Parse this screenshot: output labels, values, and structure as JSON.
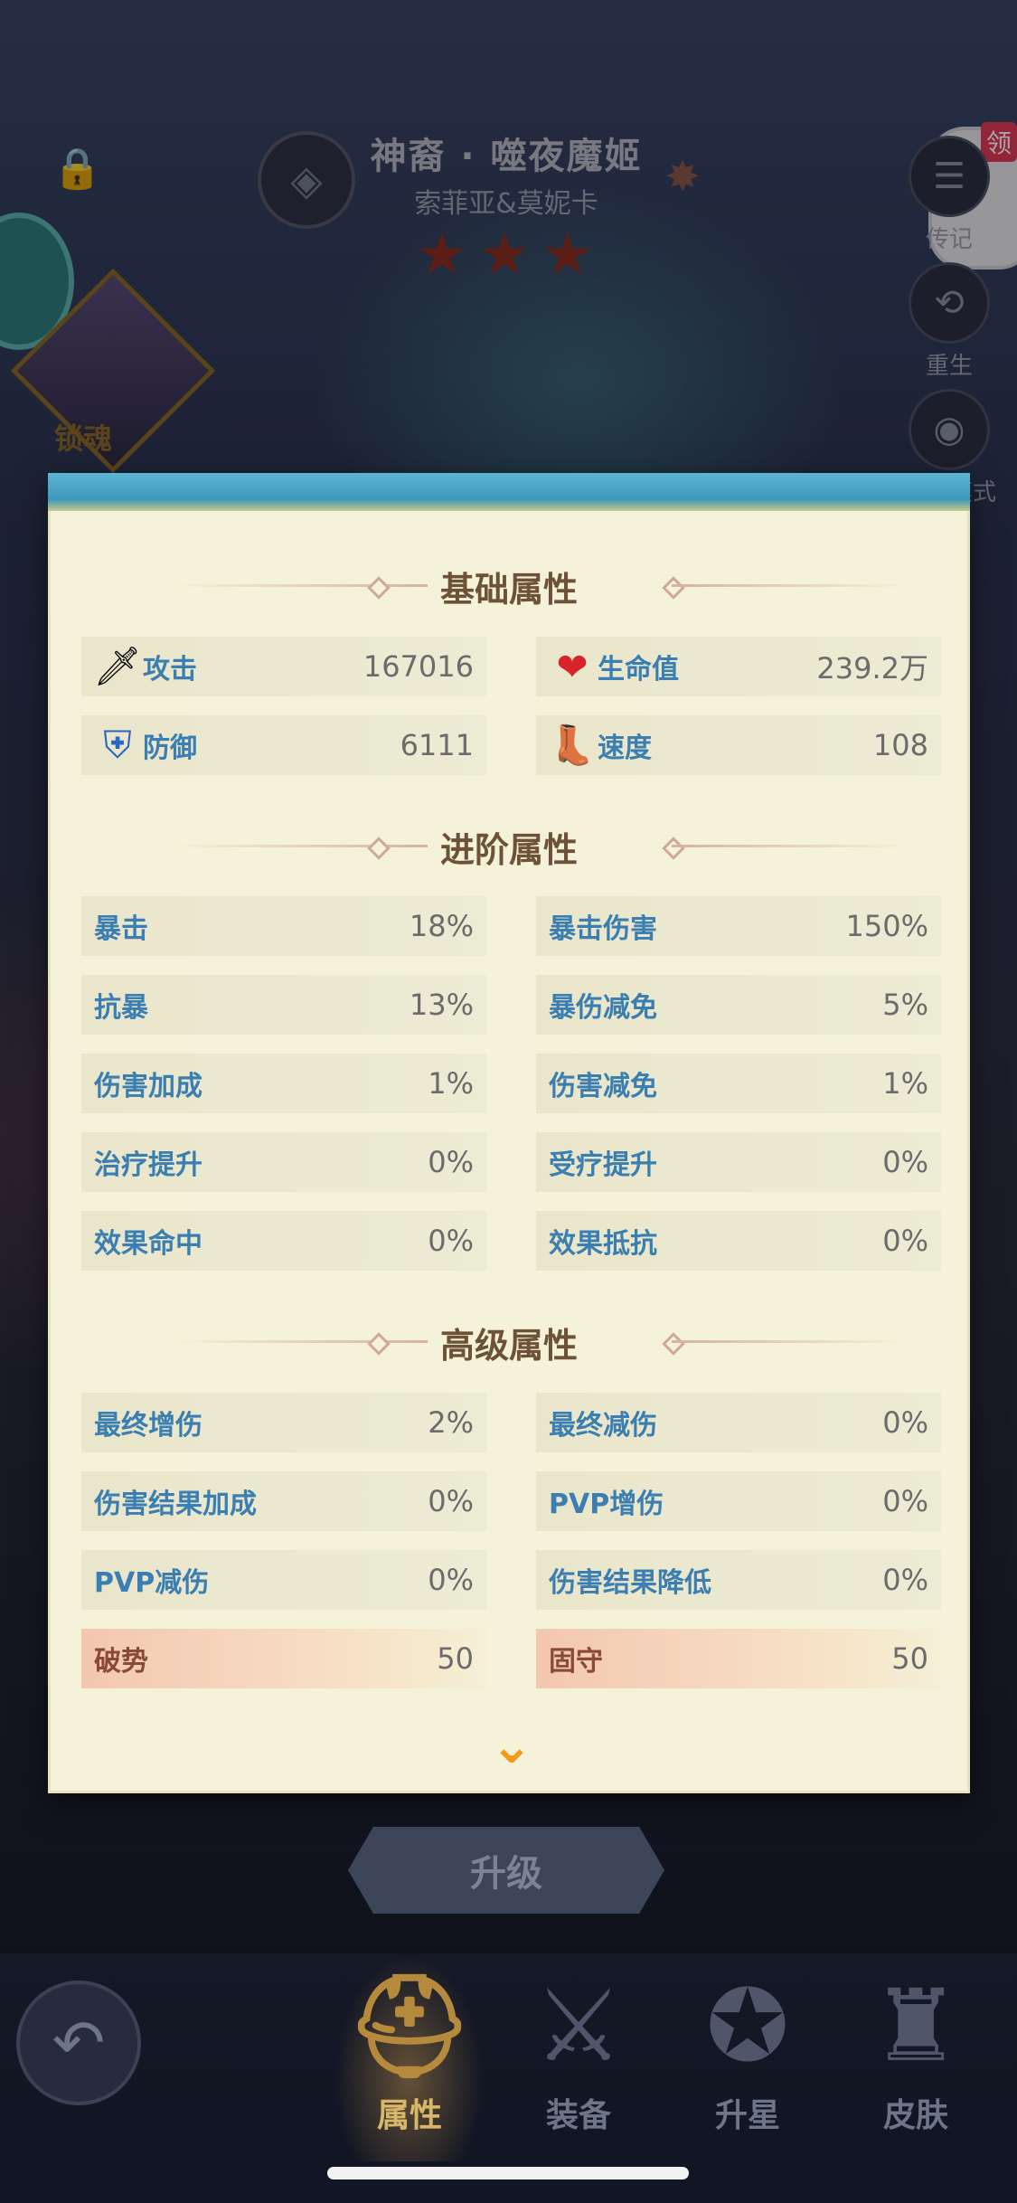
{
  "hero": {
    "name": "神裔 · 噬夜魔姬",
    "subtitle": "索菲亚&莫妮卡",
    "star_count": 3,
    "soul_lock_label": "锁魂"
  },
  "side_buttons": {
    "reward_tag": "领",
    "bio_label": "传记",
    "rebirth_label": "重生",
    "view_mode_label": "观赏模式"
  },
  "panel": {
    "basic": {
      "title": "基础属性",
      "attack": {
        "label": "攻击",
        "value": "167016"
      },
      "hp": {
        "label": "生命值",
        "value": "239.2万"
      },
      "defense": {
        "label": "防御",
        "value": "6111"
      },
      "speed": {
        "label": "速度",
        "value": "108"
      }
    },
    "advanced": {
      "title": "进阶属性",
      "items": [
        {
          "label": "暴击",
          "value": "18%"
        },
        {
          "label": "暴击伤害",
          "value": "150%"
        },
        {
          "label": "抗暴",
          "value": "13%"
        },
        {
          "label": "暴伤减免",
          "value": "5%"
        },
        {
          "label": "伤害加成",
          "value": "1%"
        },
        {
          "label": "伤害减免",
          "value": "1%"
        },
        {
          "label": "治疗提升",
          "value": "0%"
        },
        {
          "label": "受疗提升",
          "value": "0%"
        },
        {
          "label": "效果命中",
          "value": "0%"
        },
        {
          "label": "效果抵抗",
          "value": "0%"
        }
      ]
    },
    "senior": {
      "title": "高级属性",
      "items": [
        {
          "label": "最终增伤",
          "value": "2%"
        },
        {
          "label": "最终减伤",
          "value": "0%"
        },
        {
          "label": "伤害结果加成",
          "value": "0%"
        },
        {
          "label": "PVP增伤",
          "value": "0%"
        },
        {
          "label": "PVP减伤",
          "value": "0%"
        },
        {
          "label": "伤害结果降低",
          "value": "0%"
        },
        {
          "label": "破势",
          "value": "50"
        },
        {
          "label": "固守",
          "value": "50"
        }
      ]
    }
  },
  "upgrade_label": "升级",
  "tabs": [
    {
      "label": "属性",
      "icon": "helmet-icon",
      "active": true
    },
    {
      "label": "装备",
      "icon": "sword-icon",
      "active": false
    },
    {
      "label": "升星",
      "icon": "star-badge-icon",
      "active": false
    },
    {
      "label": "皮肤",
      "icon": "armor-icon",
      "active": false
    }
  ],
  "colors": {
    "label_blue": "#3a7eb2",
    "panel_bg": "#f4f2d8",
    "title_brown": "#6e5238",
    "panel_top_teal": "#3e98bb"
  }
}
